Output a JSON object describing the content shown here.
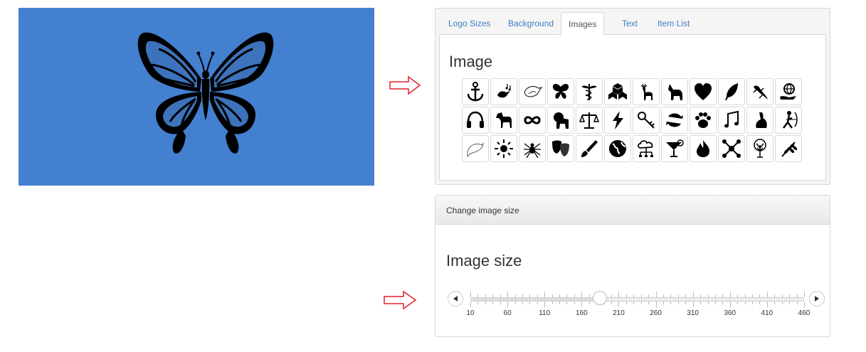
{
  "tabs": [
    "Logo Sizes",
    "Background",
    "Images",
    "Text",
    "Item List"
  ],
  "active_tab": "Images",
  "images_panel": {
    "title": "Image",
    "icons": [
      "anchor-icon",
      "bird-music-icon",
      "bird-outline-icon",
      "butterfly-icon",
      "caduceus-icon",
      "cubes-icon",
      "deer-icon",
      "dog-icon",
      "heart-icon",
      "feather-icon",
      "lizard-icon",
      "globe-hand-icon",
      "headphones-icon",
      "horse-icon",
      "infinity-icon",
      "lion-icon",
      "scales-icon",
      "lightning-icon",
      "key-icon",
      "fish-circle-icon",
      "paw-icon",
      "music-notes-icon",
      "rabbit-icon",
      "archer-icon",
      "dolphin-icon",
      "sun-icon",
      "spider-icon",
      "theater-masks-icon",
      "paintbrush-icon",
      "earth-icon",
      "cloud-network-icon",
      "cocktail-icon",
      "fire-icon",
      "molecule-icon",
      "tree-icon",
      "wheat-icon"
    ]
  },
  "size_panel": {
    "heading": "Change image size",
    "title": "Image size",
    "slider": {
      "min": 10,
      "max": 460,
      "value": 185,
      "tick_labels": [
        "10",
        "60",
        "110",
        "160",
        "210",
        "260",
        "310",
        "360",
        "410",
        "460"
      ]
    }
  },
  "colors": {
    "canvas": "#4480d0",
    "arrow": "#e0202a",
    "link": "#3d7fc4"
  }
}
